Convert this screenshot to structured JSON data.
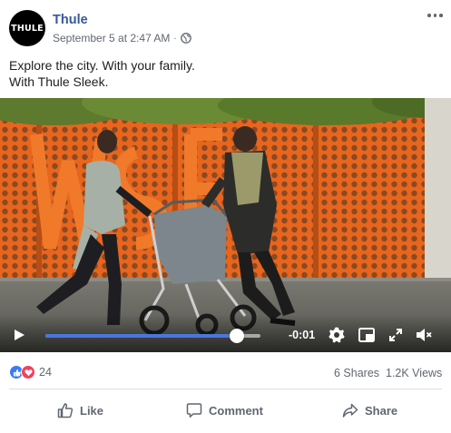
{
  "post": {
    "page_name": "Thule",
    "avatar_text": "THULE",
    "timestamp": "September 5 at 2:47 AM",
    "separator": "·",
    "audience_icon": "globe-icon",
    "more_icon": "more-options-icon",
    "text_line1": "Explore the city. With your family.",
    "text_line2": "With Thule Sleek."
  },
  "video": {
    "time_remaining": "-0:01",
    "progress_percent": 89,
    "controls": [
      "play-icon",
      "settings-icon",
      "picture-in-picture-icon",
      "fullscreen-icon",
      "mute-icon"
    ]
  },
  "stats": {
    "reaction_icons": [
      "like-icon",
      "love-icon"
    ],
    "reactions_count": "24",
    "shares": "6 Shares",
    "views": "1.2K Views"
  },
  "actions": {
    "like_label": "Like",
    "comment_label": "Comment",
    "share_label": "Share"
  },
  "colors": {
    "brand_link": "#385898",
    "progress": "#4a76e0",
    "like_blue": "#3b7cf2",
    "love_red": "#f0435d",
    "wall_orange": "#e8651e"
  }
}
